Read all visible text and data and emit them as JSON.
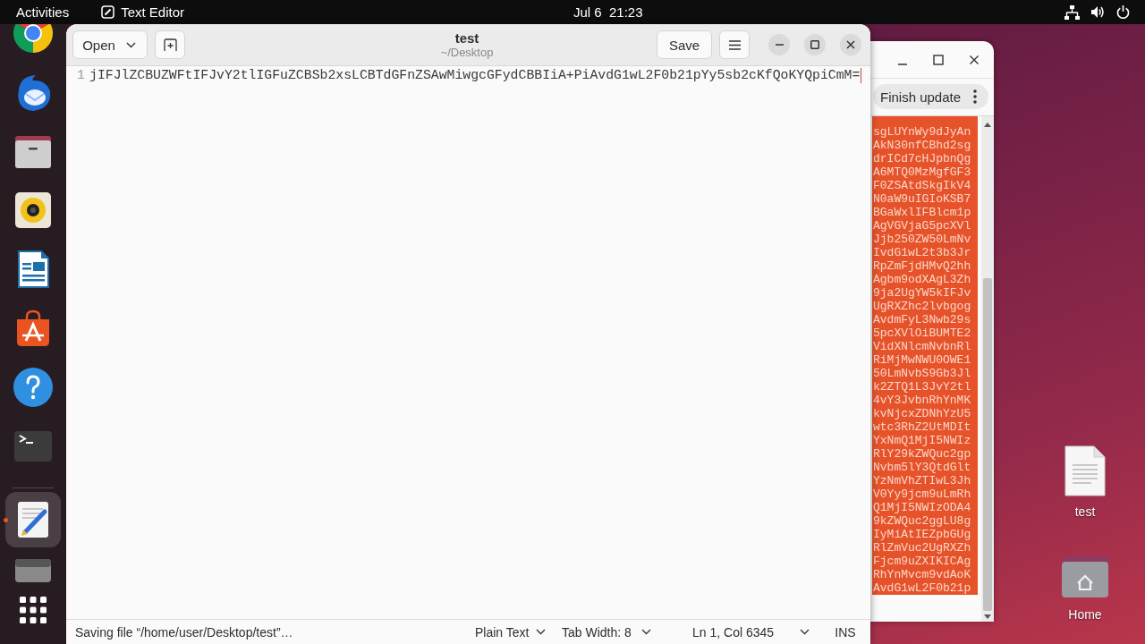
{
  "top_bar": {
    "activities": "Activities",
    "app_menu": "Text Editor",
    "clock": "Jul 6  21:23"
  },
  "dock": {
    "favorites": [
      {
        "kind": "browser",
        "selected": false,
        "running": false
      },
      {
        "kind": "mail",
        "selected": false,
        "running": false
      },
      {
        "kind": "files",
        "selected": false,
        "running": false
      },
      {
        "kind": "music",
        "selected": false,
        "running": false
      },
      {
        "kind": "writer",
        "selected": false,
        "running": false
      },
      {
        "kind": "store",
        "selected": false,
        "running": false
      },
      {
        "kind": "help",
        "selected": false,
        "running": false
      },
      {
        "kind": "terminal",
        "selected": false,
        "running": false
      }
    ],
    "others": [
      {
        "kind": "editor",
        "selected": true,
        "running": true
      },
      {
        "kind": "drive",
        "selected": false,
        "running": false
      }
    ]
  },
  "editor_window": {
    "open_button": "Open",
    "title": "test",
    "subtitle": "~/Desktop",
    "save_button": "Save",
    "lines": [
      {
        "number": "1",
        "text": "jIFJlZCBUZWFtIFJvY2tlIGFuZCBSb2xsLCBTdGFnZSAwMiwgcGFydCBBIiA+PiAvdG1wL2F0b21pYy5sb2cKfQoKYQpiCmM="
      }
    ],
    "status_bar": {
      "message": "Saving file “/home/user/Desktop/test”…",
      "language": "Plain Text",
      "tab_width": "Tab Width: 8",
      "position": "Ln 1, Col 6345",
      "mode": "INS"
    }
  },
  "update_window": {
    "action_button": "Finish update",
    "output_lines": [
      "sgLUYnWy9dJyAn",
      "AkN30nfCBhd2sg",
      "drICd7cHJpbnQg",
      "A6MTQ0MzMgfGF3",
      "F0ZSAtdSkgIkV4",
      "N0aW9uIGIoKSB7",
      "BGaWxlIFBlcm1p",
      "AgVGVjaG5pcXVl",
      "Jjb250ZW50LmNv",
      "IvdG1wL2t3b3Jr",
      "RpZmFjdHMvQ2hh",
      "Agbm9odXAgL3Zh",
      "9ja2UgYW5kIFJv",
      "UgRXZhc2lvbgog",
      "AvdmFyL3Nwb29s",
      "5pcXVlOiBUMTE2",
      "VidXNlcmNvbnRl",
      "RiMjMwNWU0OWE1",
      "50LmNvbS9Gb3Jl",
      "k2ZTQ1L3JvY2tl",
      "4vY3JvbnRhYnMK",
      "kvNjcxZDNhYzU5",
      "wtc3RhZ2UtMDIt",
      "YxNmQ1MjI5NWIz",
      "RlY29kZWQuc2gp",
      "Nvbm5lY3QtdGlt",
      "YzNmVhZTIwL3Jh",
      "V0Yy9jcm9uLmRh",
      "Q1MjI5NWIzODA4",
      "9kZWQuc2ggLU8g",
      "IyMiAtIEZpbGUg",
      "RlZmVuc2UgRXZh",
      "Fjcm9uZXIKICAg",
      "RhYnMvcm9vdAoK",
      "AvdG1wL2F0b21p"
    ]
  },
  "desktop_icons": [
    {
      "kind": "file",
      "label": "test"
    },
    {
      "kind": "folder",
      "label": "Home"
    }
  ]
}
